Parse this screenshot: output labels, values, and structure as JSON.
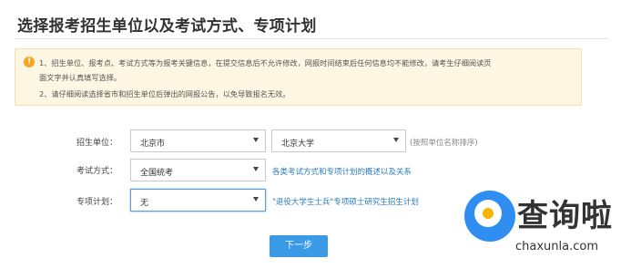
{
  "page": {
    "title": "选择报考招生单位以及考试方式、专项计划"
  },
  "notice": {
    "icon": "exclamation-icon",
    "line1": "1、招生单位、报考点、考试方式等为报考关键信息，在提交信息后不允许修改，网报时间结束后任何信息均不能修改，请考生仔细阅读页",
    "line2": "面文字并认真填写选择。",
    "line3": "2、请仔细阅读选择省市和招生单位后弹出的网报公告，以免导致报名无效。"
  },
  "form": {
    "unit_label": "招生单位：",
    "province_value": "北京市",
    "school_value": "北京大学",
    "unit_hint": "(按照单位名称排序)",
    "exam_label": "考试方式：",
    "exam_value": "全国统考",
    "exam_link": "各类考试方式和专项计划的概述以及关系",
    "plan_label": "专项计划：",
    "plan_value": "无",
    "plan_link": "\"退役大学生士兵\"专项硕士研究生招生计划"
  },
  "actions": {
    "next_label": "下一步"
  },
  "watermark": {
    "text_cn": "查询啦",
    "text_en": "chaxunla.com",
    "brand_color": "#2f8ef0"
  },
  "colors": {
    "accent": "#3a9ae6",
    "link": "#2b7bbf",
    "notice_bg": "#fdf6e3"
  }
}
